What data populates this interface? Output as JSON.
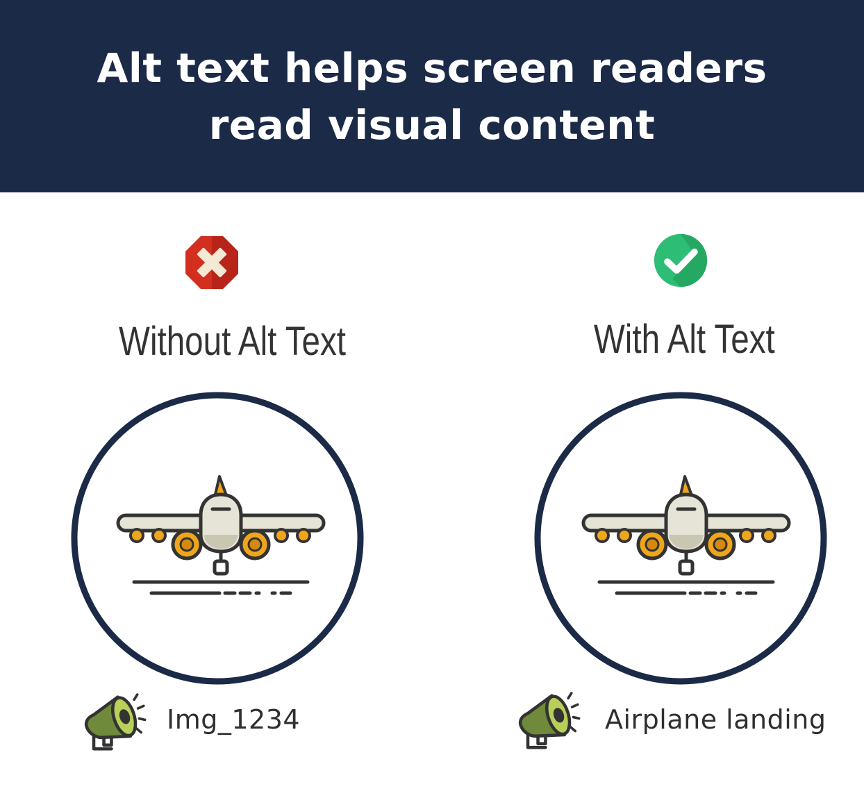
{
  "header": {
    "title_line1": "Alt text helps screen readers",
    "title_line2": "read visual content",
    "background": "#1b2a47"
  },
  "panels": [
    {
      "status": "error",
      "status_icon": "x-octagon-icon",
      "status_color": "#d32f1f",
      "title": "Without Alt Text",
      "image_icon": "airplane-landing-icon",
      "speaker_icon": "megaphone-icon",
      "caption": "Img_1234"
    },
    {
      "status": "success",
      "status_icon": "check-circle-icon",
      "status_color": "#2dbd74",
      "title": "With Alt Text",
      "image_icon": "airplane-landing-icon",
      "speaker_icon": "megaphone-icon",
      "caption": "Airplane landing"
    }
  ]
}
